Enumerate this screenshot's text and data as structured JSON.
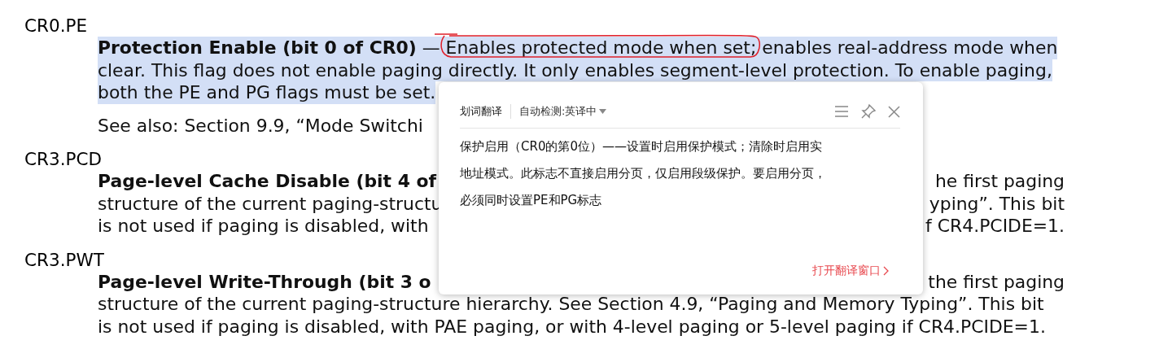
{
  "entries": [
    {
      "term": "CR0.PE",
      "lines": [
        {
          "kind": "text",
          "left": "**Protection Enable (bit 0 of CR0)** — Enables protected mode when set; enables real-address mode when",
          "selected": true
        },
        {
          "kind": "text",
          "left": "clear. This flag does not enable paging directly. It only enables segment-level protection. To enable paging,",
          "selected": true
        },
        {
          "kind": "text",
          "left": "both the PE and PG flags must be set.",
          "selected": true
        },
        {
          "kind": "note",
          "left": "See also: Section 9.9, “Mode Switchi",
          "selected": false
        }
      ]
    },
    {
      "term": "CR3.PCD",
      "lines": [
        {
          "kind": "heading",
          "left": "Page-level Cache Disable (bit 4 of",
          "right": "he first paging",
          "selected": false
        },
        {
          "kind": "text",
          "left": "structure of the current paging-structu",
          "right": "yping”. This bit",
          "selected": false
        },
        {
          "kind": "text",
          "left": "is not used if paging is disabled, with",
          "right": "f CR4.PCIDE=1.",
          "selected": false
        }
      ]
    },
    {
      "term": "CR3.PWT",
      "lines": [
        {
          "kind": "heading",
          "left": "Page-level Write-Through (bit 3 o",
          "right": "the first paging",
          "selected": false
        },
        {
          "kind": "text",
          "left": "structure of the current paging-structure hierarchy. See Section 4.9, “Paging and Memory Typing”. This bit",
          "selected": false
        },
        {
          "kind": "text",
          "left": "is not used if paging is disabled, with PAE paging, or with 4-level paging or 5-level paging if CR4.PCIDE=1.",
          "selected": false
        }
      ]
    }
  ],
  "popup": {
    "title": "划词翻译",
    "mode": "自动检测:英译中",
    "translation": "保护启用（CR0的第0位）——设置时启用保护模式；清除时启用实地址模式。此标志不直接启用分页，仅启用段级保护。要启用分页，必须同时设置PE和PG标志",
    "link": "打开翻译窗口"
  }
}
